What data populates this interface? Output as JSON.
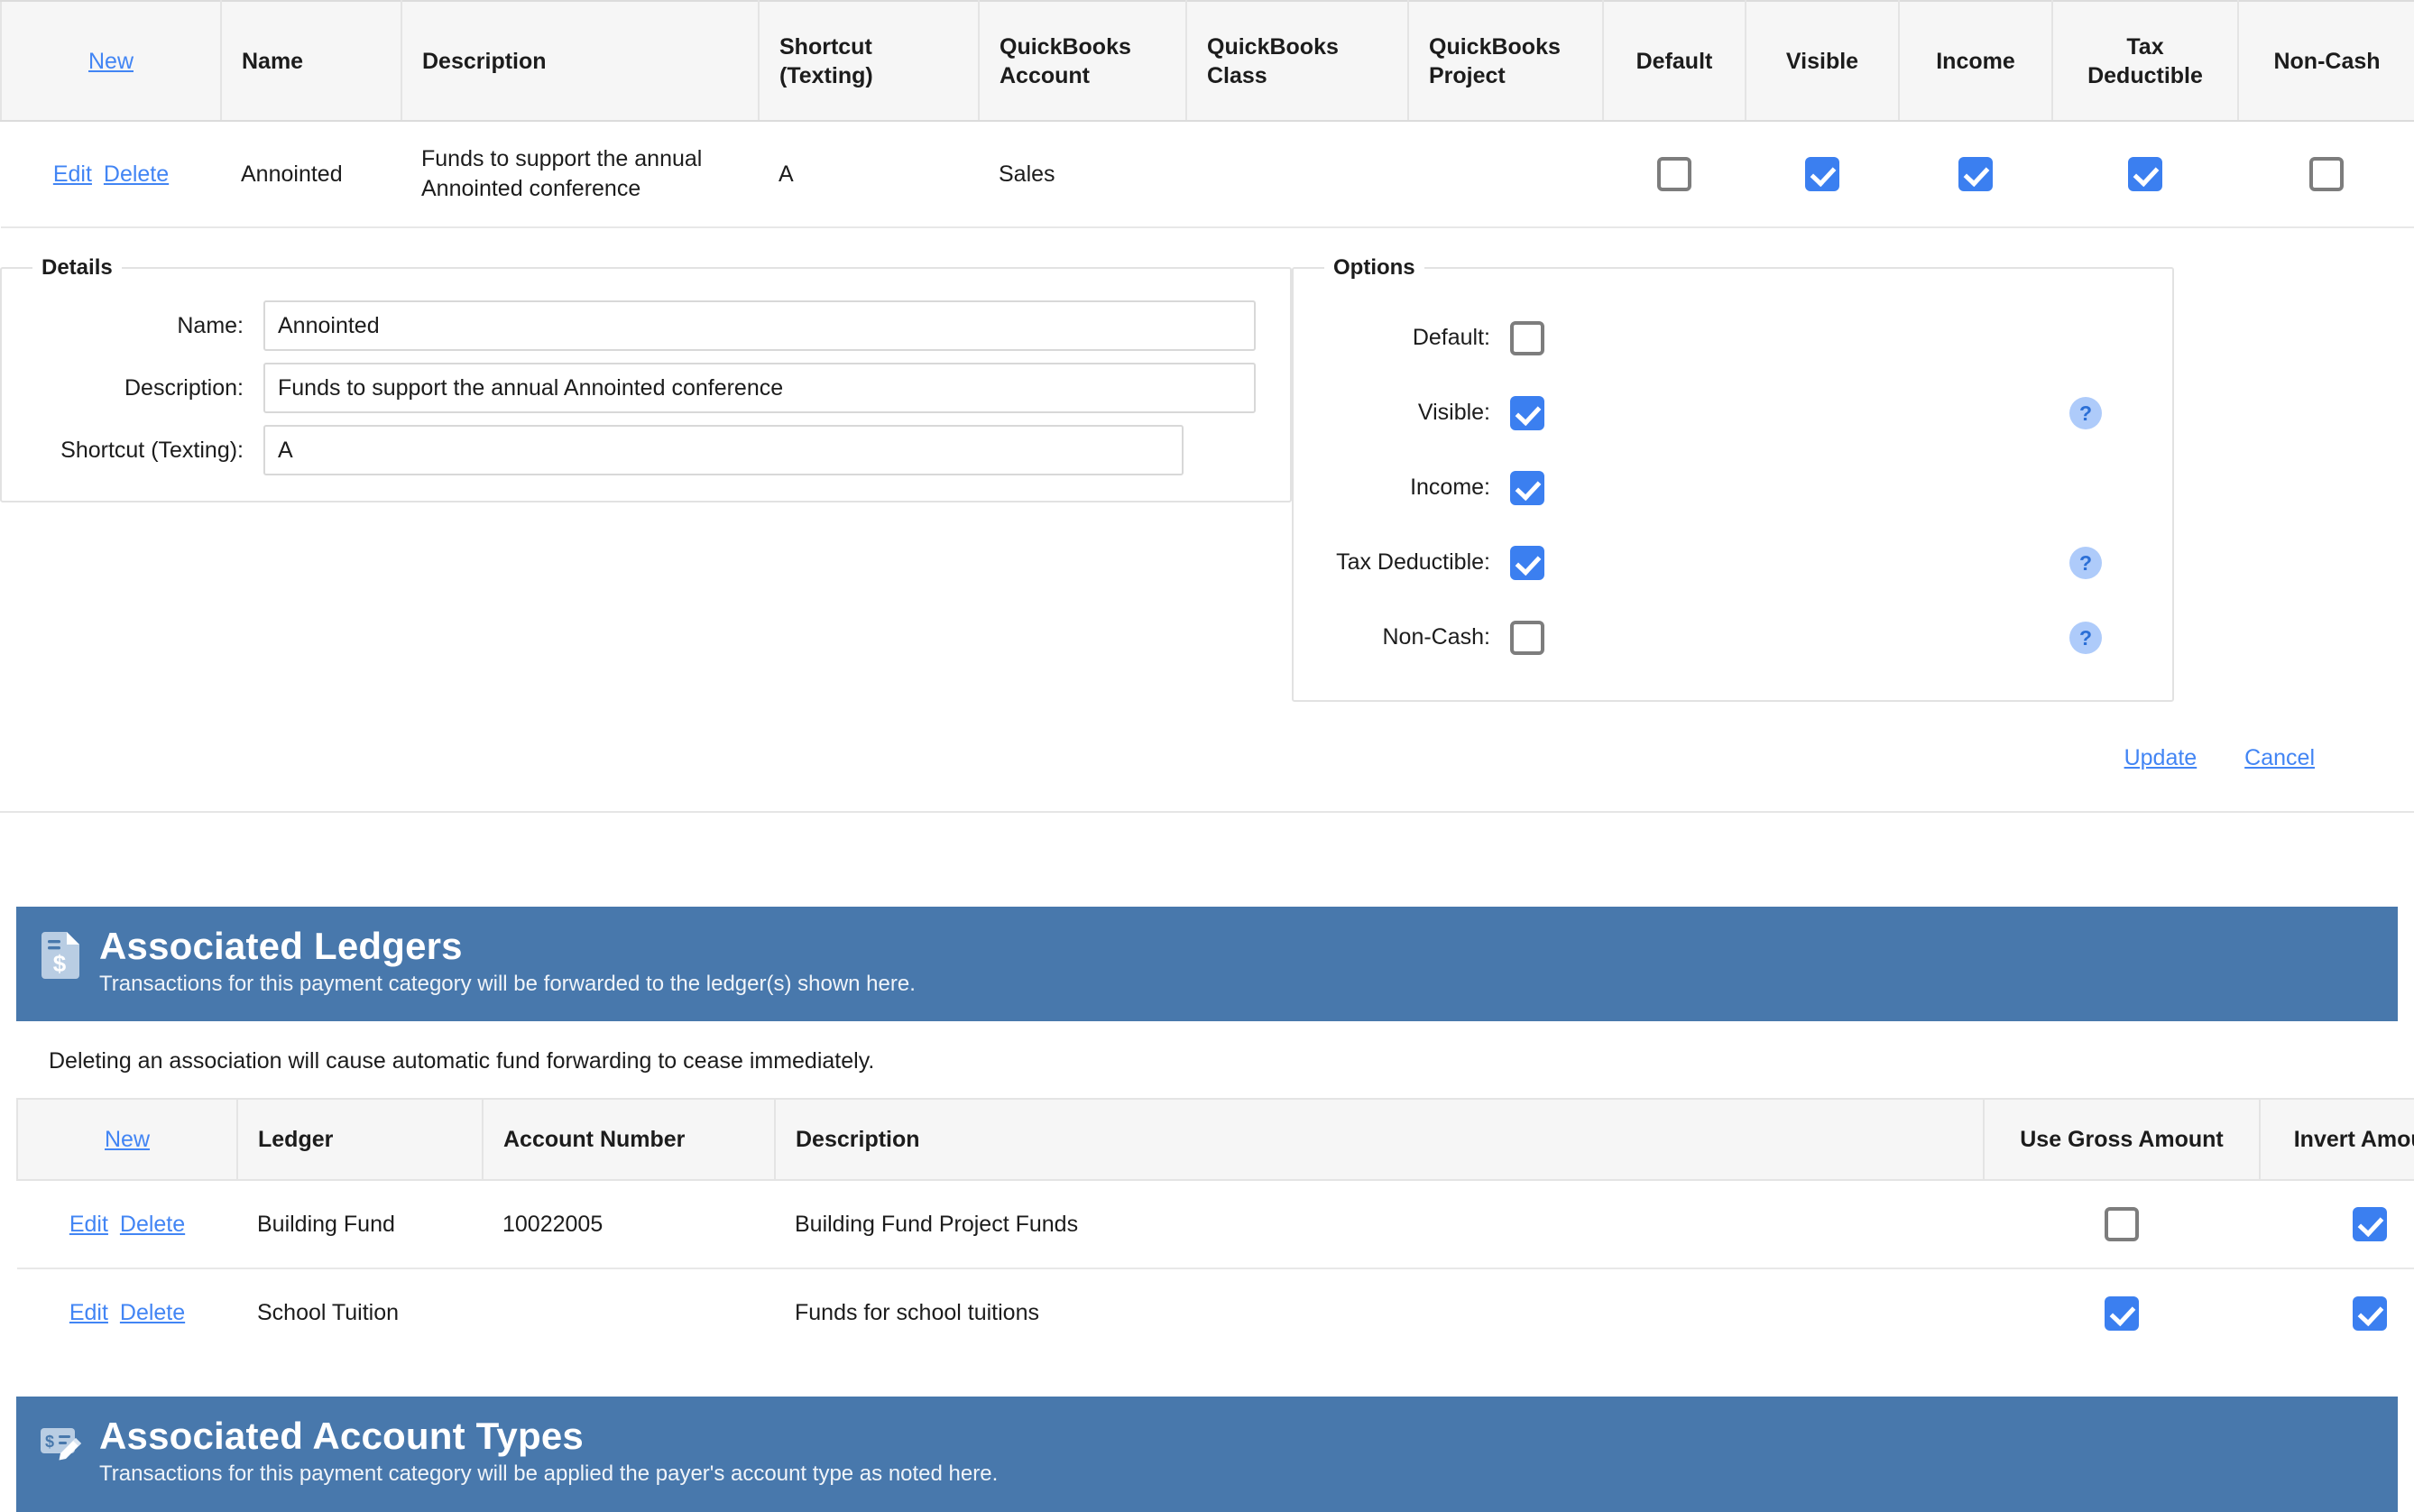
{
  "category_table": {
    "headers": {
      "new_link": "New",
      "name": "Name",
      "description": "Description",
      "shortcut": "Shortcut (Texting)",
      "qb_account": "QuickBooks Account",
      "qb_class": "QuickBooks Class",
      "qb_project": "QuickBooks Project",
      "default": "Default",
      "visible": "Visible",
      "income": "Income",
      "tax_deductible": "Tax Deductible",
      "non_cash": "Non-Cash"
    },
    "rows": [
      {
        "edit_label": "Edit",
        "delete_label": "Delete",
        "name": "Annointed",
        "description": "Funds to support the annual Annointed conference",
        "shortcut": "A",
        "qb_account": "Sales",
        "qb_class": "",
        "qb_project": "",
        "default": false,
        "visible": true,
        "income": true,
        "tax_deductible": true,
        "non_cash": false
      }
    ]
  },
  "edit_panel": {
    "details": {
      "legend": "Details",
      "name_label": "Name:",
      "name_value": "Annointed",
      "description_label": "Description:",
      "description_value": "Funds to support the annual Annointed conference",
      "shortcut_label": "Shortcut (Texting):",
      "shortcut_value": "A"
    },
    "options": {
      "legend": "Options",
      "rows": [
        {
          "label": "Default:",
          "checked": false,
          "help": false
        },
        {
          "label": "Visible:",
          "checked": true,
          "help": true
        },
        {
          "label": "Income:",
          "checked": true,
          "help": false
        },
        {
          "label": "Tax Deductible:",
          "checked": true,
          "help": true
        },
        {
          "label": "Non-Cash:",
          "checked": false,
          "help": true
        }
      ],
      "help_glyph": "?"
    },
    "update_label": "Update",
    "cancel_label": "Cancel"
  },
  "associated_ledgers": {
    "icon": "invoice-dollar-icon",
    "title": "Associated Ledgers",
    "subtitle": "Transactions for this payment category will be forwarded to the ledger(s) shown here.",
    "note": "Deleting an association will cause automatic fund forwarding to cease immediately.",
    "headers": {
      "new_link": "New",
      "ledger": "Ledger",
      "account_number": "Account Number",
      "description": "Description",
      "use_gross_amount": "Use Gross Amount",
      "invert_amount": "Invert Amount"
    },
    "rows": [
      {
        "edit_label": "Edit",
        "delete_label": "Delete",
        "ledger": "Building Fund",
        "account_number": "10022005",
        "description": "Building Fund Project Funds",
        "use_gross_amount": false,
        "invert_amount": true
      },
      {
        "edit_label": "Edit",
        "delete_label": "Delete",
        "ledger": "School Tuition",
        "account_number": "",
        "description": "Funds for school tuitions",
        "use_gross_amount": true,
        "invert_amount": true
      }
    ]
  },
  "associated_account_types": {
    "icon": "check-edit-icon",
    "title": "Associated Account Types",
    "subtitle": "Transactions for this payment category will be applied the payer's account type as noted here."
  },
  "colors": {
    "link": "#4285f4",
    "checkbox_on": "#3b7ff0",
    "checkbox_off_border": "#7d7d7d",
    "section_header_bg": "#4878ac",
    "help_bg": "#aecbfa",
    "help_fg": "#2b6fd6",
    "table_header_bg": "#f6f6f6"
  }
}
